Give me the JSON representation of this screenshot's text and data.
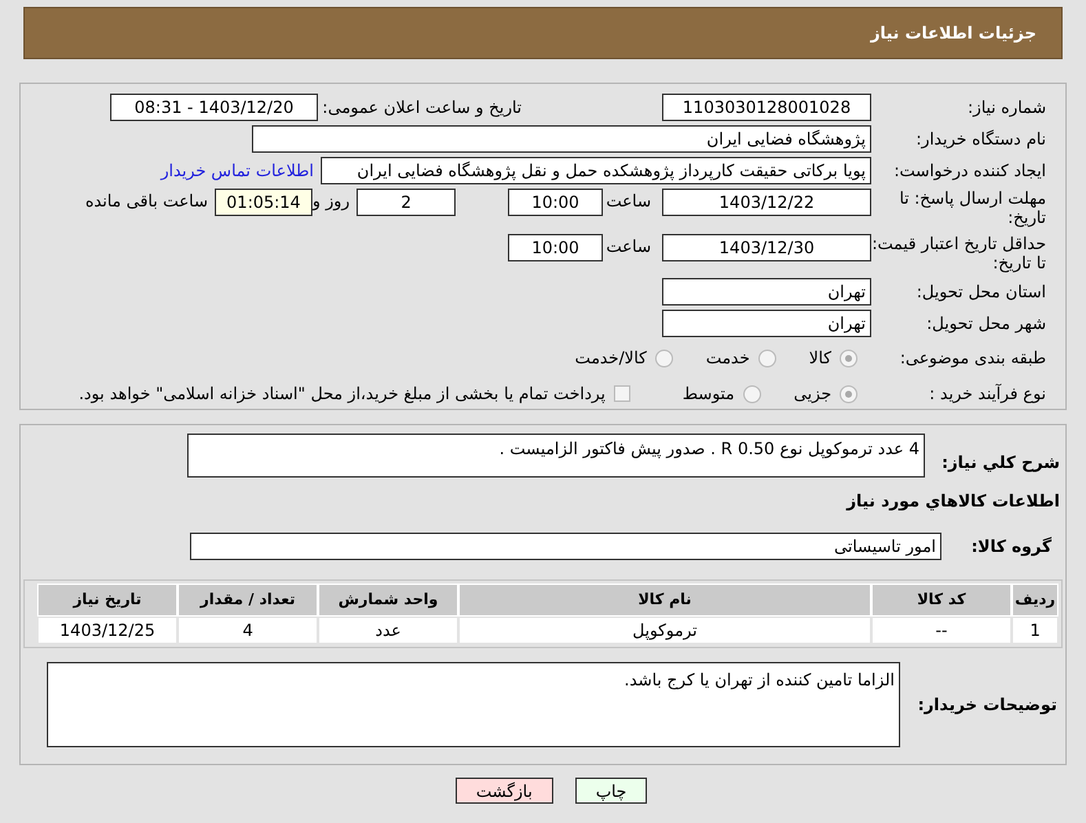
{
  "header": {
    "title": "جزئیات اطلاعات نیاز"
  },
  "need_number": {
    "label": "شماره نیاز:",
    "value": "1103030128001028"
  },
  "announce": {
    "label": "تاریخ و ساعت اعلان عمومی:",
    "value": "1403/12/20 - 08:31"
  },
  "buyer_org": {
    "label": "نام دستگاه خریدار:",
    "value": "پژوهشگاه فضایی ایران"
  },
  "requester": {
    "label": "ایجاد کننده درخواست:",
    "value": "پویا برکاتی حقیقت کارپرداز پژوهشکده حمل و نقل پژوهشگاه فضایی ایران",
    "link": "اطلاعات تماس خریدار"
  },
  "reply_deadline": {
    "label": "مهلت ارسال پاسخ: تا تاریخ:",
    "date": "1403/12/22",
    "time_label": "ساعت",
    "time": "10:00",
    "days": "2",
    "days_label": "روز و",
    "remaining": "01:05:14",
    "remaining_label": "ساعت باقی مانده"
  },
  "price_validity": {
    "label": "حداقل تاریخ اعتبار قیمت: تا تاریخ:",
    "date": "1403/12/30",
    "time_label": "ساعت",
    "time": "10:00"
  },
  "province": {
    "label": "استان محل تحویل:",
    "value": "تهران"
  },
  "city": {
    "label": "شهر محل تحویل:",
    "value": "تهران"
  },
  "category": {
    "label": "طبقه بندی موضوعی:",
    "options": [
      {
        "label": "کالا",
        "selected": true
      },
      {
        "label": "خدمت",
        "selected": false
      },
      {
        "label": "کالا/خدمت",
        "selected": false
      }
    ]
  },
  "purchase_type": {
    "label": "نوع فرآیند خرید :",
    "options": [
      {
        "label": "جزیی",
        "selected": true
      },
      {
        "label": "متوسط",
        "selected": false
      }
    ],
    "payment": {
      "checked": false,
      "text": "پرداخت تمام یا بخشی از مبلغ خرید،از محل \"اسناد خزانه اسلامی\" خواهد بود."
    }
  },
  "description": {
    "label": "شرح کلي نياز:",
    "value": "4 عدد ترموکوپل  نوع R 0.50 . صدور پیش فاکتور الزامیست ."
  },
  "goods_title": "اطلاعات کالاهاي مورد نياز",
  "goods_group": {
    "label": "گروه کالا:",
    "value": "امور تاسیساتی"
  },
  "table": {
    "columns": [
      "ردیف",
      "کد کالا",
      "نام کالا",
      "واحد شمارش",
      "تعداد / مقدار",
      "تاریخ نیاز"
    ],
    "rows": [
      [
        "1",
        "--",
        "ترموکوپل",
        "عدد",
        "4",
        "1403/12/25"
      ]
    ]
  },
  "buyer_notes": {
    "label": "توضیحات خریدار:",
    "value": "الزاما تامین کننده از تهران یا کرج باشد."
  },
  "buttons": [
    {
      "label": "چاپ",
      "kind": "print"
    },
    {
      "label": "بازگشت",
      "kind": "back"
    }
  ]
}
